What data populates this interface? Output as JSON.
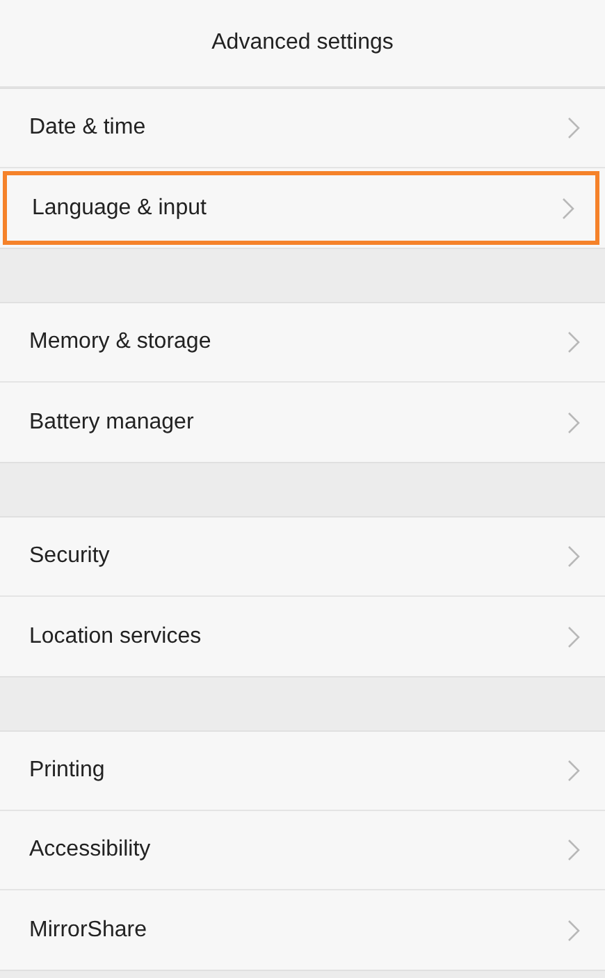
{
  "header": {
    "title": "Advanced settings"
  },
  "groups": [
    {
      "items": [
        {
          "label": "Date & time",
          "highlighted": false
        },
        {
          "label": "Language & input",
          "highlighted": true
        }
      ]
    },
    {
      "items": [
        {
          "label": "Memory & storage",
          "highlighted": false
        },
        {
          "label": "Battery manager",
          "highlighted": false
        }
      ]
    },
    {
      "items": [
        {
          "label": "Security",
          "highlighted": false
        },
        {
          "label": "Location services",
          "highlighted": false
        }
      ]
    },
    {
      "items": [
        {
          "label": "Printing",
          "highlighted": false
        },
        {
          "label": "Accessibility",
          "highlighted": false
        },
        {
          "label": "MirrorShare",
          "highlighted": false
        }
      ]
    }
  ]
}
